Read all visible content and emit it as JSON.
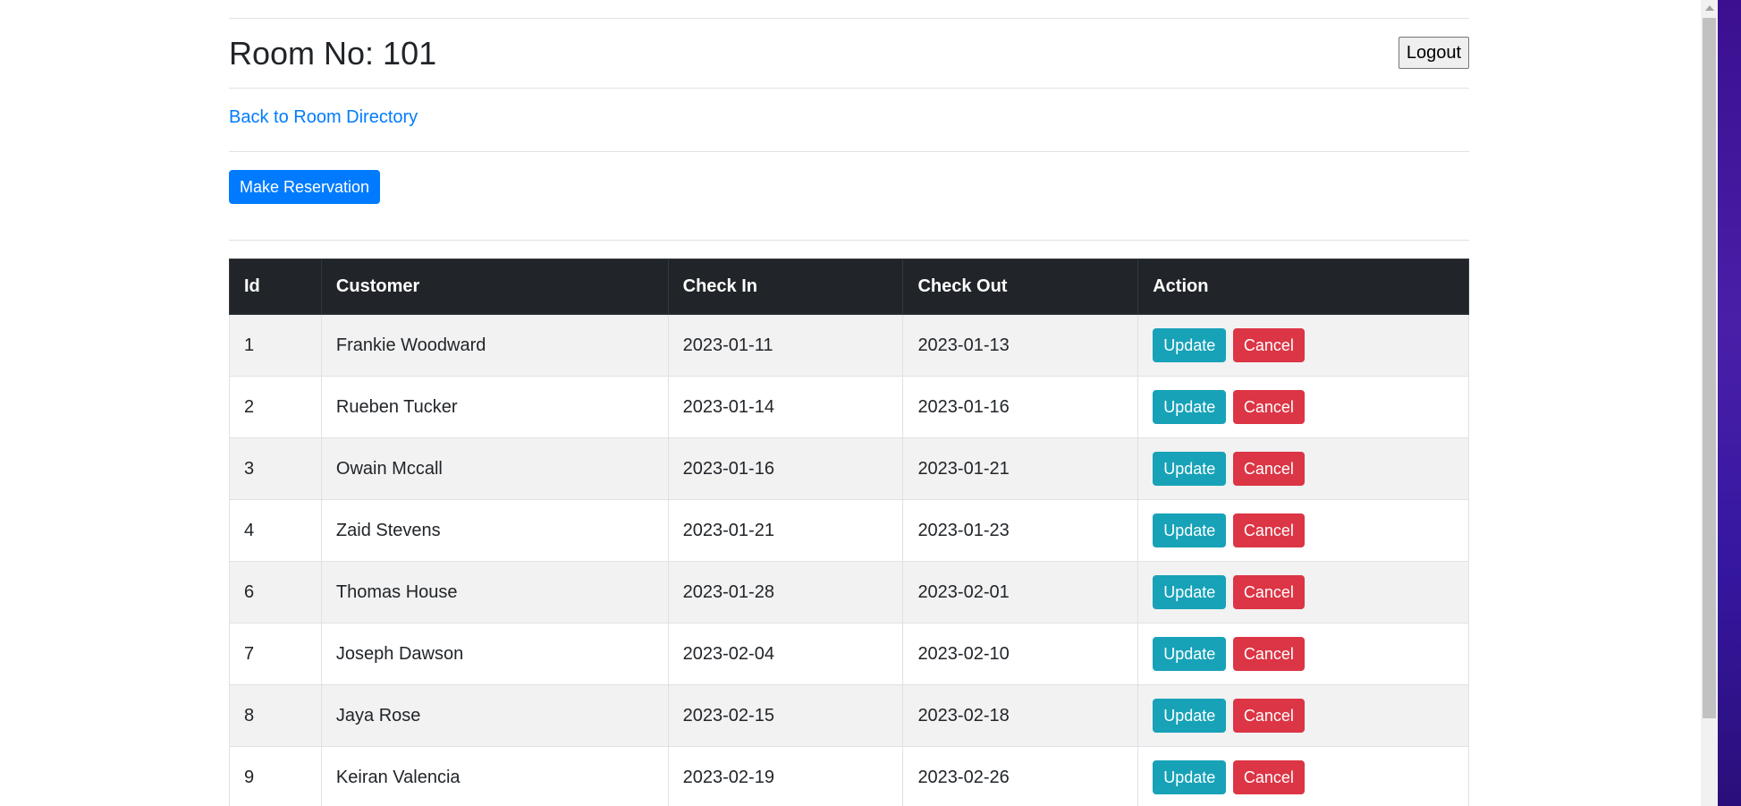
{
  "header": {
    "title": "Room No: 101",
    "logout_label": "Logout"
  },
  "nav": {
    "back_label": "Back to Room Directory"
  },
  "actions": {
    "make_reservation_label": "Make Reservation"
  },
  "table": {
    "columns": [
      "Id",
      "Customer",
      "Check In",
      "Check Out",
      "Action"
    ],
    "rows": [
      {
        "id": "1",
        "customer": "Frankie Woodward",
        "check_in": "2023-01-11",
        "check_out": "2023-01-13"
      },
      {
        "id": "2",
        "customer": "Rueben Tucker",
        "check_in": "2023-01-14",
        "check_out": "2023-01-16"
      },
      {
        "id": "3",
        "customer": "Owain Mccall",
        "check_in": "2023-01-16",
        "check_out": "2023-01-21"
      },
      {
        "id": "4",
        "customer": "Zaid Stevens",
        "check_in": "2023-01-21",
        "check_out": "2023-01-23"
      },
      {
        "id": "6",
        "customer": "Thomas House",
        "check_in": "2023-01-28",
        "check_out": "2023-02-01"
      },
      {
        "id": "7",
        "customer": "Joseph Dawson",
        "check_in": "2023-02-04",
        "check_out": "2023-02-10"
      },
      {
        "id": "8",
        "customer": "Jaya Rose",
        "check_in": "2023-02-15",
        "check_out": "2023-02-18"
      },
      {
        "id": "9",
        "customer": "Keiran Valencia",
        "check_in": "2023-02-19",
        "check_out": "2023-02-26"
      }
    ],
    "update_label": "Update",
    "cancel_label": "Cancel"
  },
  "colors": {
    "primary": "#007bff",
    "info": "#17a2b8",
    "danger": "#dc3545",
    "table_header": "#212529"
  }
}
